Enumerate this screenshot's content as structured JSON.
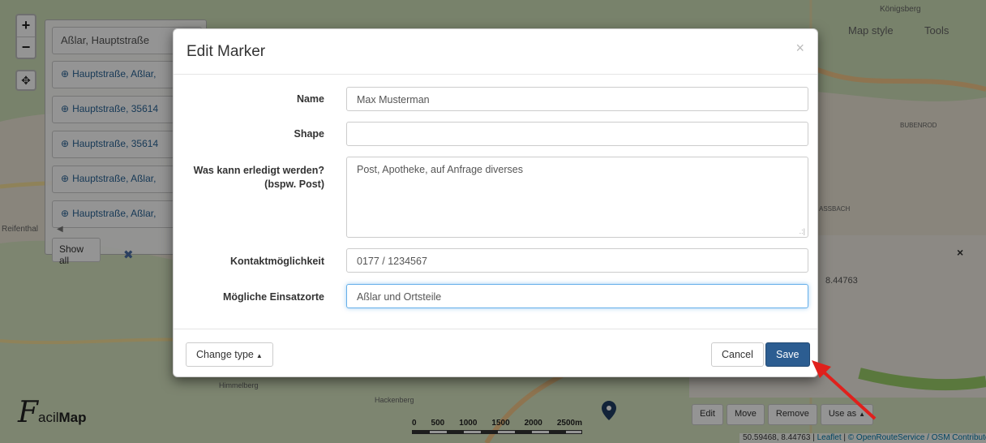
{
  "map": {
    "search_value": "Aßlar, Hauptstraße",
    "results": [
      "Hauptstraße, Aßlar,",
      "Hauptstraße, 35614",
      "Hauptstraße, 35614",
      "Hauptstraße, Aßlar,",
      "Hauptstraße, Aßlar,"
    ],
    "show_all_label": "Show all",
    "zoom_in": "+",
    "zoom_out": "−",
    "map_style_label": "Map style",
    "tools_label": "Tools",
    "place_labels": [
      "Königsberg",
      "BUBENROD",
      "Reifenthal",
      "Himmelberg",
      "ASSBACH",
      "Hackenberg"
    ],
    "coord_mid": "8.44763",
    "bottom_buttons": [
      "Edit",
      "Move",
      "Remove",
      "Use as"
    ],
    "attribution_coords": "50.59468, 8.44763",
    "attribution_leaflet": "Leaflet",
    "attribution_rest": "© OpenRouteService / OSM Contributors",
    "scale_labels": [
      "0",
      "500",
      "1000",
      "1500",
      "2000",
      "2500m"
    ],
    "logo_f": "F",
    "logo_rest_1": "acil",
    "logo_rest_2": "Map",
    "colors": {
      "primary": "#2c5d91",
      "link": "#2a6496",
      "arrow": "#e0201c"
    }
  },
  "modal": {
    "title": "Edit Marker",
    "close": "×",
    "fields": {
      "name": {
        "label": "Name",
        "value": "Max Musterman"
      },
      "shape": {
        "label": "Shape",
        "value": ""
      },
      "todo": {
        "label_1": "Was kann erledigt werden?",
        "label_2": "(bspw. Post)",
        "value": "Post, Apotheke, auf Anfrage diverses"
      },
      "contact": {
        "label": "Kontaktmöglichkeit",
        "value": "0177 / 1234567"
      },
      "places": {
        "label": "Mögliche Einsatzorte",
        "value": "Aßlar und Ortsteile"
      }
    },
    "change_type_label": "Change type",
    "cancel_label": "Cancel",
    "save_label": "Save"
  }
}
